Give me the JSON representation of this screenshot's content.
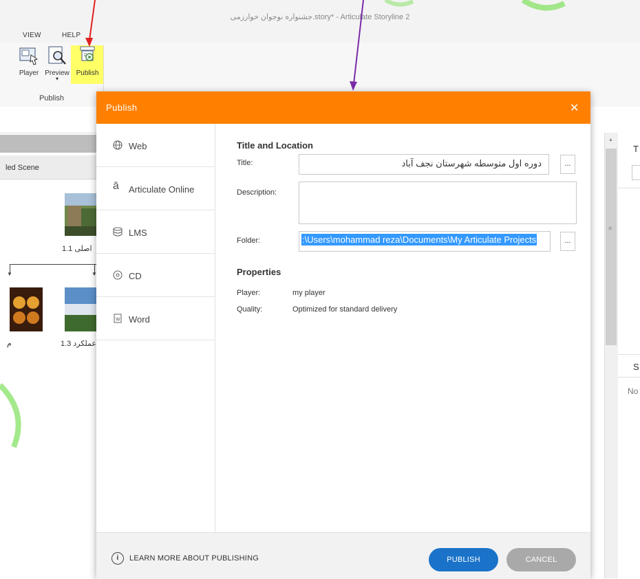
{
  "app": {
    "window_title": "جشنواره نوجوان خوارزمی.story* - Articulate Storyline 2"
  },
  "menu": {
    "items": [
      "VIEW",
      "HELP"
    ]
  },
  "ribbon": {
    "buttons": [
      {
        "label": "Player",
        "icon": "player-icon"
      },
      {
        "label": "Preview",
        "icon": "preview-icon",
        "dropdown": true
      },
      {
        "label": "Publish",
        "icon": "publish-icon",
        "highlighted": true
      }
    ],
    "group_label": "Publish"
  },
  "story_view": {
    "scene_title": "led Scene",
    "slides": [
      {
        "label": "اصلی 1.1"
      },
      {
        "label": "عملکرد 1.3"
      },
      {
        "label": "م"
      }
    ]
  },
  "right_panel": {
    "header1": "T",
    "header2": "S",
    "body2": "No"
  },
  "dialog": {
    "title": "Publish",
    "nav": [
      {
        "label": "Web",
        "icon": "globe-icon"
      },
      {
        "label": "Articulate Online",
        "icon": "articulate-online-icon"
      },
      {
        "label": "LMS",
        "icon": "database-icon"
      },
      {
        "label": "CD",
        "icon": "cd-icon"
      },
      {
        "label": "Word",
        "icon": "word-document-icon"
      }
    ],
    "title_location": {
      "heading": "Title and Location",
      "title_label": "Title:",
      "title_value": "دوره اول متوسطه شهرستان نجف آباد",
      "description_label": "Description:",
      "description_value": "",
      "folder_label": "Folder:",
      "folder_value": ":\\Users\\mohammad reza\\Documents\\My Articulate Projects",
      "browse_label": "..."
    },
    "properties": {
      "heading": "Properties",
      "player_label": "Player:",
      "player_value": "my player",
      "quality_label": "Quality:",
      "quality_value": "Optimized for standard delivery"
    },
    "footer": {
      "learn_more": "LEARN MORE ABOUT PUBLISHING",
      "publish_button": "PUBLISH",
      "cancel_button": "CANCEL"
    }
  },
  "colors": {
    "dialog_header": "#ff8000",
    "publish_button": "#1a73c9",
    "cancel_button": "#a9a9a9",
    "highlight": "#ffff66",
    "selection": "#3399ff",
    "arrow_red": "#e02020",
    "arrow_purple": "#7a2ca8",
    "watermark": "#7ee05a"
  }
}
